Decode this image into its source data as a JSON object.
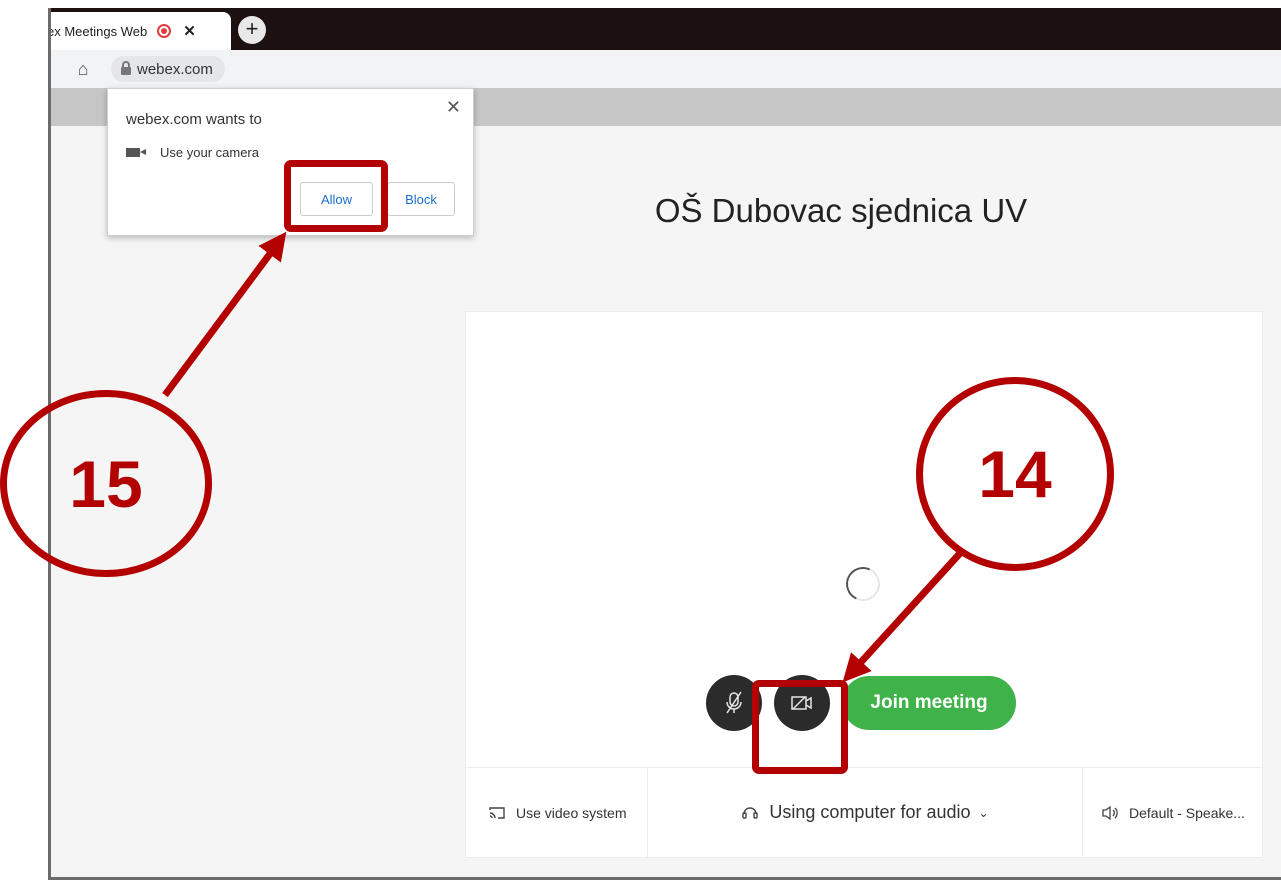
{
  "browser": {
    "tab_title": "ex Meetings Web",
    "tab_close": "✕",
    "new_tab": "+",
    "url": "webex.com"
  },
  "permission_popup": {
    "title": "webex.com wants to",
    "permission": "Use your camera",
    "allow_label": "Allow",
    "block_label": "Block",
    "close": "✕"
  },
  "meeting": {
    "title": "OŠ Dubovac sjednica UV",
    "join_label": "Join meeting",
    "video_system_label": "Use video system",
    "audio_label": "Using computer for audio",
    "speaker_label": "Default - Speake..."
  },
  "annotations": {
    "step_15": "15",
    "step_14": "14",
    "color": "#b30000"
  },
  "colors": {
    "join_green": "#3fb349",
    "link_blue": "#1a6fd1",
    "tabbar_dark": "#1c1110"
  },
  "icons": [
    "home-icon",
    "lock-icon",
    "camera-icon",
    "mic-muted-icon",
    "camera-off-icon",
    "headset-icon",
    "cast-icon",
    "speaker-icon",
    "chevron-down-icon",
    "record-icon"
  ]
}
